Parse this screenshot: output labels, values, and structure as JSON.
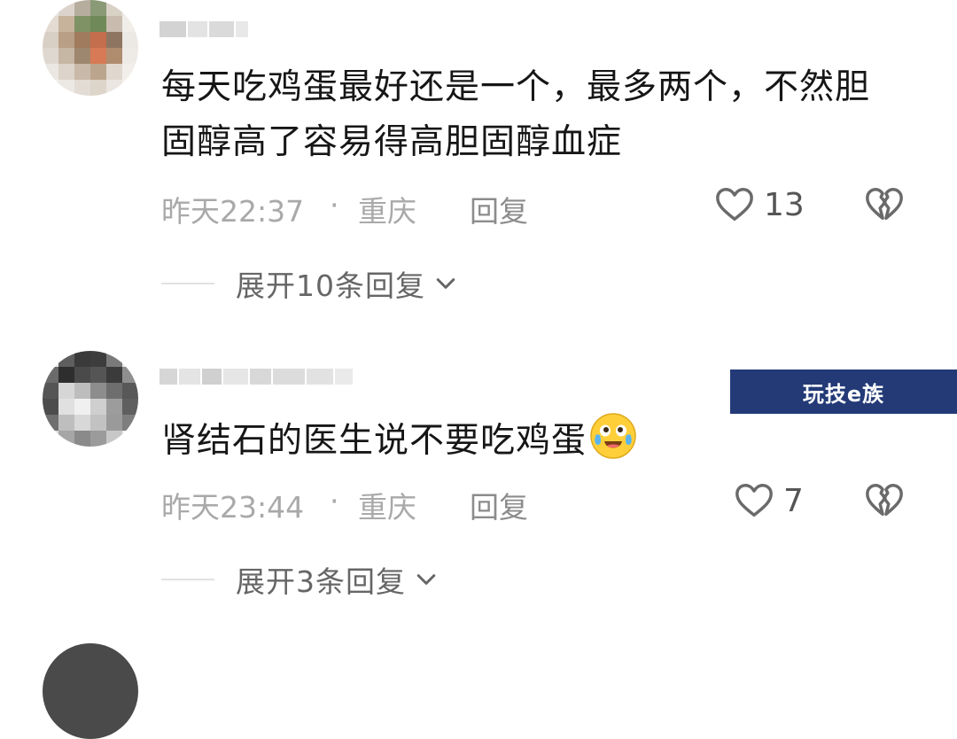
{
  "comments": [
    {
      "content": "每天吃鸡蛋最好还是一个，最多两个，不然胆固醇高了容易得高胆固醇血症",
      "time": "昨天22:37",
      "separator": "·",
      "location": "重庆",
      "reply_label": "回复",
      "likes": "13",
      "expand_label": "展开10条回复",
      "avatar_colors": [
        "#eae6e2",
        "#dcd4cc",
        "#b7ad9f",
        "#8a9a76",
        "#d9d0c6",
        "#eeeae6",
        "#e4dcd2",
        "#c7b39c",
        "#7f9266",
        "#6f8a58",
        "#c9bcaf",
        "#f1ede9",
        "#d8cfc5",
        "#b89f85",
        "#a07b5d",
        "#c56e4d",
        "#8e7561",
        "#ece8e4",
        "#dfd8d0",
        "#c6b6a4",
        "#9e876f",
        "#d77a55",
        "#b08c6f",
        "#eeeae6",
        "#ebe7e3",
        "#dcd4ca",
        "#c9b9a8",
        "#bca58d",
        "#e0d8ce",
        "#f2eeea",
        "#f3f0ed",
        "#ece8e4",
        "#e3dcd4",
        "#ddd4ca",
        "#ebe6e1",
        "#f5f2ef"
      ]
    },
    {
      "content": "肾结石的医生说不要吃鸡蛋",
      "time": "昨天23:44",
      "separator": "·",
      "location": "重庆",
      "reply_label": "回复",
      "likes": "7",
      "expand_label": "展开3条回复",
      "avatar_colors": [
        "#e7e7e7",
        "#5e5e5e",
        "#3a3a3a",
        "#3d3d3d",
        "#7a7a7a",
        "#e9e9e9",
        "#6b6b6b",
        "#2e2e2e",
        "#4a4a4a",
        "#555555",
        "#3b3b3b",
        "#8f8f8f",
        "#555555",
        "#d6d6d6",
        "#bdbdbd",
        "#8d8d8d",
        "#6e6e6e",
        "#585858",
        "#4c4c4c",
        "#e0e0e0",
        "#f0f0f0",
        "#cfcfcf",
        "#9c9c9c",
        "#5f5f5f",
        "#6f6f6f",
        "#bebebe",
        "#d8d8d8",
        "#c2c2c2",
        "#9a9a9a",
        "#7e7e7e",
        "#dcdcdc",
        "#a6a6a6",
        "#8a8a8a",
        "#9b9b9b",
        "#c7c7c7",
        "#ececec"
      ]
    }
  ],
  "watermark": "玩技e族",
  "colors": {
    "text": "#161616",
    "meta": "#a9a9a9",
    "watermark_bg": "#233a77"
  },
  "icons": {
    "like": "heart-outline-icon",
    "dislike": "broken-heart-icon",
    "expand": "chevron-down-icon",
    "emoji": "crying-laughing-emoji-icon"
  }
}
